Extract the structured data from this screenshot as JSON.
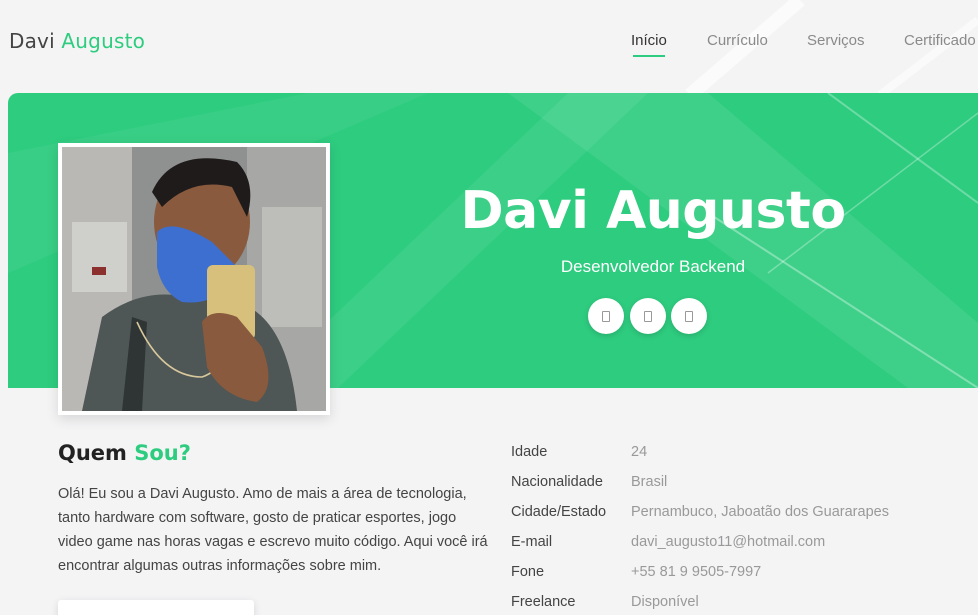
{
  "brand": {
    "first": "Davi",
    "second": "Augusto"
  },
  "nav": {
    "items": [
      {
        "label": "Início",
        "active": true
      },
      {
        "label": "Currículo",
        "active": false
      },
      {
        "label": "Serviços",
        "active": false
      },
      {
        "label": "Certificado",
        "active": false
      }
    ]
  },
  "hero": {
    "name": "Davi Augusto",
    "role": "Desenvolvedor Backend",
    "socials": [
      {
        "icon": "social-icon"
      },
      {
        "icon": "social-icon"
      },
      {
        "icon": "social-icon"
      }
    ]
  },
  "about": {
    "title_first": "Quem",
    "title_accent": "Sou?",
    "text": "Olá! Eu sou a Davi Augusto. Amo de mais a área de tecnologia, tanto hardware com software, gosto de praticar esportes, jogo video game nas horas vagas e escrevo muito código. Aqui você irá encontrar algumas outras informações sobre mim."
  },
  "info": [
    {
      "label": "Idade",
      "value": "24"
    },
    {
      "label": "Nacionalidade",
      "value": "Brasil"
    },
    {
      "label": "Cidade/Estado",
      "value": "Pernambuco, Jaboatão dos Guararapes"
    },
    {
      "label": "E-mail",
      "value": "davi_augusto11@hotmail.com"
    },
    {
      "label": "Fone",
      "value": "+55 81 9 9505-7997"
    },
    {
      "label": "Freelance",
      "value": "Disponível"
    }
  ],
  "colors": {
    "accent": "#2ecc7f",
    "background": "#f4f4f5"
  }
}
